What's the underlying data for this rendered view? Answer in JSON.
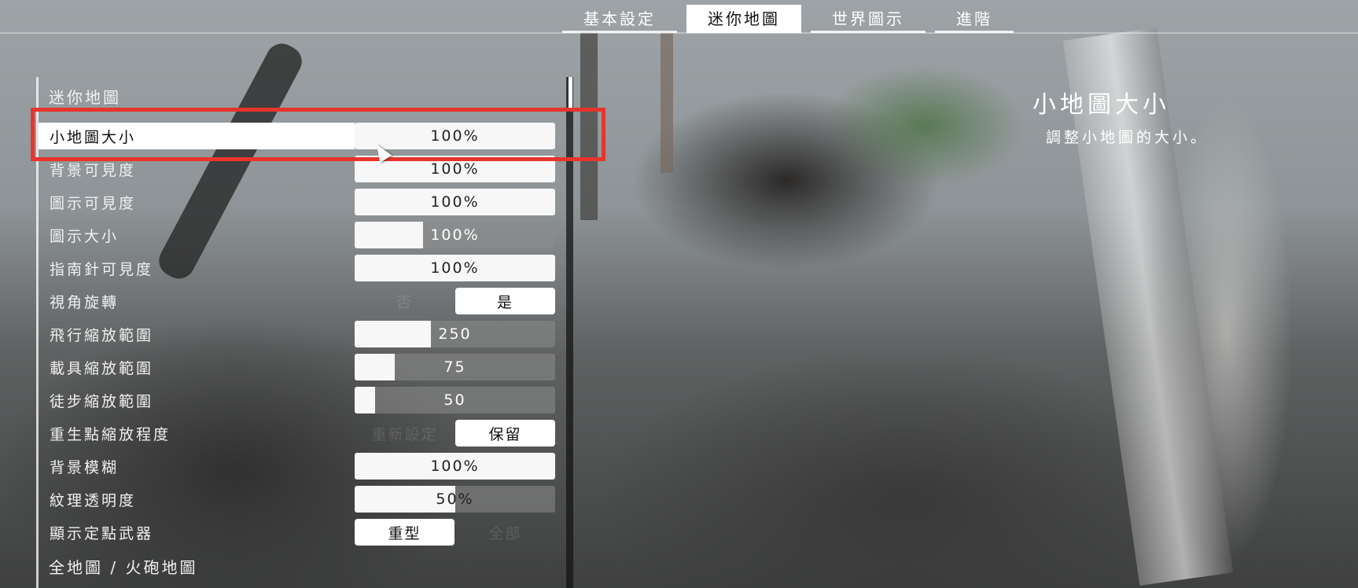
{
  "tabs": [
    {
      "label": "基本設定",
      "active": false
    },
    {
      "label": "迷你地圖",
      "active": true
    },
    {
      "label": "世界圖示",
      "active": false
    },
    {
      "label": "進階",
      "active": false
    }
  ],
  "sections": {
    "minimap_title": "迷你地圖",
    "fullmap_title": "全地圖 / 火砲地圖"
  },
  "settings": [
    {
      "label": "小地圖大小",
      "type": "slider",
      "value": "100%",
      "fill": 1.0,
      "highlighted": true
    },
    {
      "label": "背景可見度",
      "type": "slider",
      "value": "100%",
      "fill": 1.0
    },
    {
      "label": "圖示可見度",
      "type": "slider",
      "value": "100%",
      "fill": 1.0
    },
    {
      "label": "圖示大小",
      "type": "slider",
      "value": "100%",
      "fill": 0.34
    },
    {
      "label": "指南針可見度",
      "type": "slider",
      "value": "100%",
      "fill": 1.0
    },
    {
      "label": "視角旋轉",
      "type": "toggle",
      "options": [
        "否",
        "是"
      ],
      "selected": 1
    },
    {
      "label": "飛行縮放範圍",
      "type": "slider",
      "value": "250",
      "fill": 0.38
    },
    {
      "label": "載具縮放範圍",
      "type": "slider",
      "value": "75",
      "fill": 0.2
    },
    {
      "label": "徒步縮放範圍",
      "type": "slider",
      "value": "50",
      "fill": 0.1
    },
    {
      "label": "重生點縮放程度",
      "type": "toggle",
      "options": [
        "重新設定",
        "保留"
      ],
      "selected": 1
    },
    {
      "label": "背景模糊",
      "type": "slider",
      "value": "100%",
      "fill": 1.0
    },
    {
      "label": "紋理透明度",
      "type": "slider",
      "value": "50%",
      "fill": 0.5
    },
    {
      "label": "顯示定點武器",
      "type": "toggle",
      "options": [
        "重型",
        "全部"
      ],
      "selected": 0
    }
  ],
  "description": {
    "title": "小地圖大小",
    "text": "調整小地圖的大小。"
  },
  "colors": {
    "highlight_box": "#e8342c",
    "active_tab_bg": "#ffffff"
  }
}
